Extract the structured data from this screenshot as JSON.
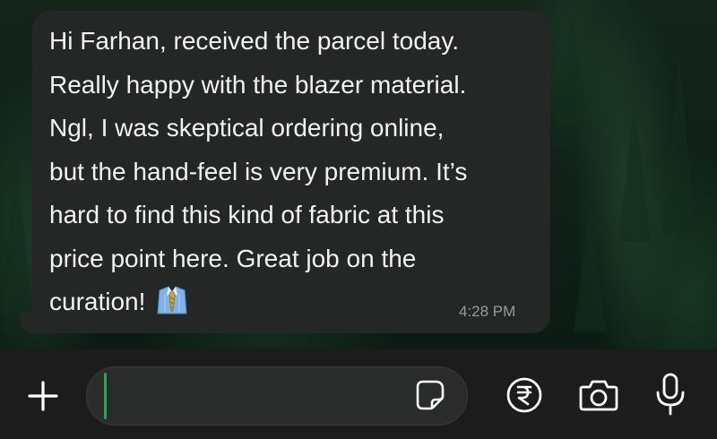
{
  "message": {
    "text": "Hi Farhan, received the parcel today.\nReally happy with the blazer material.\nNgl, I was skeptical ordering online,\nbut the hand-feel is very premium. It’s\nhard to find this kind of fabric at this\nprice point here. Great job on the\ncuration! ",
    "emoji_icon": "necktie-shirt-emoji",
    "time": "4:28 PM"
  },
  "composer": {
    "input_value": "",
    "icons": [
      "plus-icon",
      "sticker-icon",
      "rupee-payment-icon",
      "camera-icon",
      "microphone-icon"
    ]
  },
  "colors": {
    "bubble": "#252626",
    "composer_bg": "#1c1c1d",
    "caret": "#1faa59",
    "text": "#f2f2f2",
    "timestamp": "#9a9a9a"
  }
}
